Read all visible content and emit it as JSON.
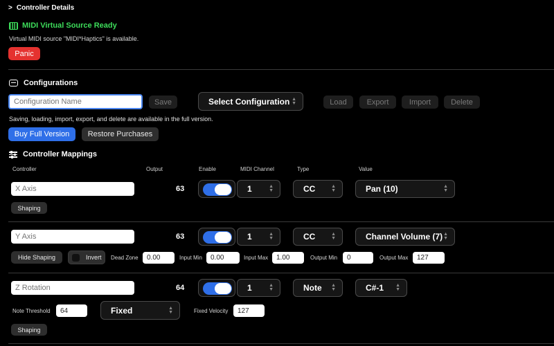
{
  "header": {
    "disclosure_label": "Controller Details",
    "midi_status": "MIDI Virtual Source Ready",
    "midi_info": "Virtual MIDI source \"MIDI*Haptics\" is available.",
    "panic_label": "Panic"
  },
  "configurations": {
    "title": "Configurations",
    "name_placeholder": "Configuration Name",
    "save_label": "Save",
    "select_label": "Select Configuration",
    "load_label": "Load",
    "export_label": "Export",
    "import_label": "Import",
    "delete_label": "Delete",
    "notice": "Saving, loading, import, export, and delete are available in the full version.",
    "buy_label": "Buy Full Version",
    "restore_label": "Restore Purchases"
  },
  "mappings": {
    "title": "Controller Mappings",
    "columns": {
      "controller": "Controller",
      "output": "Output",
      "enable": "Enable",
      "midi_channel": "MIDI Channel",
      "type": "Type",
      "value": "Value"
    },
    "rows": [
      {
        "placeholder": "X Axis",
        "output": "63",
        "enabled": true,
        "channel": "1",
        "type": "CC",
        "value": "Pan (10)",
        "shaping_label": "Shaping"
      },
      {
        "placeholder": "Y Axis",
        "output": "63",
        "enabled": true,
        "channel": "1",
        "type": "CC",
        "value": "Channel Volume (7)",
        "hide_shaping_label": "Hide Shaping",
        "invert_label": "Invert",
        "dead_zone_label": "Dead Zone",
        "dead_zone": "0.00",
        "input_min_label": "Input Min",
        "input_min": "0.00",
        "input_max_label": "Input Max",
        "input_max": "1.00",
        "output_min_label": "Output Min",
        "output_min": "0",
        "output_max_label": "Output Max",
        "output_max": "127"
      },
      {
        "placeholder": "Z Rotation",
        "output": "64",
        "enabled": true,
        "channel": "1",
        "type": "Note",
        "value": "C#-1",
        "note_threshold_label": "Note Threshold",
        "note_threshold": "64",
        "velocity_mode": "Fixed",
        "fixed_velocity_label": "Fixed Velocity",
        "fixed_velocity": "127",
        "shaping_label": "Shaping"
      }
    ]
  },
  "colors": {
    "background": "#000000",
    "accent_blue": "#2f6fe8",
    "status_green": "#3ddc5a",
    "danger_red": "#e5322f"
  }
}
